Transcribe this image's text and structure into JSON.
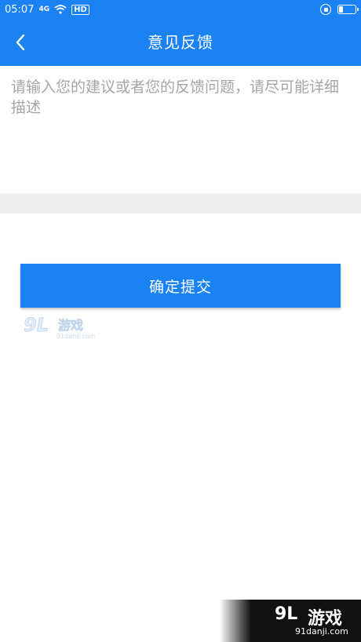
{
  "status_bar": {
    "time": "05:07",
    "signal": "4G",
    "network_badge": "HD",
    "icons": [
      "signal-icon",
      "wifi-icon",
      "hd-icon",
      "rotation-lock-icon",
      "battery-icon"
    ],
    "battery_level": 0.3
  },
  "header": {
    "title": "意见反馈",
    "back_icon": "chevron-left-icon"
  },
  "feedback": {
    "placeholder": "请输入您的建议或者您的反馈问题，请尽可能详细描述",
    "value": ""
  },
  "submit": {
    "label": "确定提交"
  },
  "watermark": {
    "mark": "9L",
    "name": "游戏",
    "url": "91danji.com"
  },
  "colors": {
    "primary": "#1a82f2",
    "divider": "#efefef",
    "placeholder": "#a6a6a6"
  }
}
